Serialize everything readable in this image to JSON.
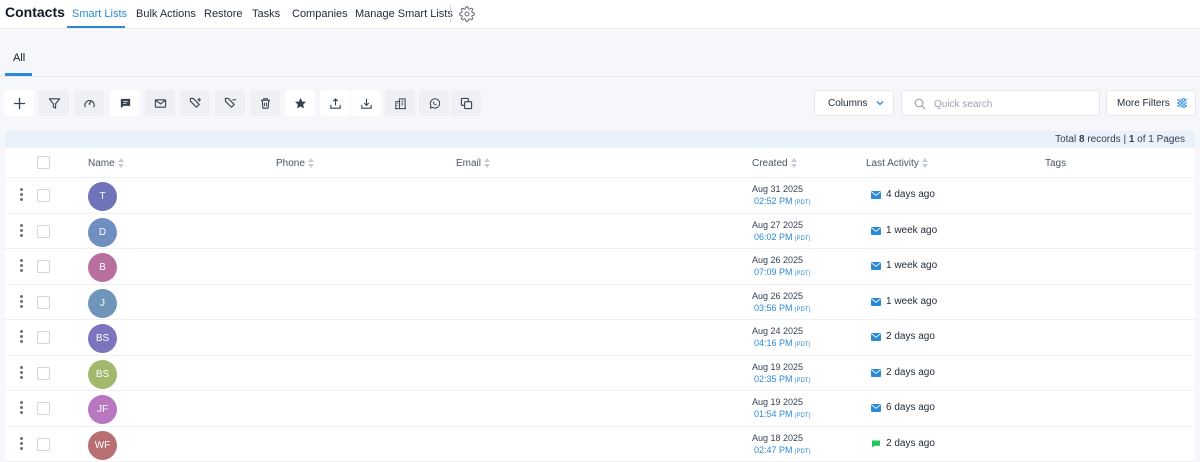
{
  "app": {
    "title": "Contacts"
  },
  "nav": {
    "tabs": [
      {
        "label": "Smart Lists"
      },
      {
        "label": "Bulk Actions"
      },
      {
        "label": "Restore"
      },
      {
        "label": "Tasks"
      },
      {
        "label": "Companies"
      },
      {
        "label": "Manage Smart Lists"
      }
    ],
    "active_tab": "Smart Lists",
    "settings_icon": "gear-icon"
  },
  "subtabs": [
    {
      "label": "All"
    }
  ],
  "toolbar": {
    "icons": [
      "plus-icon",
      "filter-icon",
      "pipeline-icon",
      "sms-icon",
      "email-icon",
      "add-tag-icon",
      "remove-tag-icon",
      "trash-icon",
      "star-icon",
      "export-icon",
      "import-icon",
      "company-icon",
      "whatsapp-icon",
      "merge-icon"
    ],
    "columns_label": "Columns",
    "search_placeholder": "Quick search",
    "more_filters_label": "More Filters"
  },
  "records": {
    "prefix": "Total ",
    "total": "8",
    "middle": " records | ",
    "page": "1",
    "suffix": " of 1 Pages"
  },
  "table": {
    "columns": [
      "Name",
      "Phone",
      "Email",
      "Created",
      "Last Activity",
      "Tags"
    ],
    "rows": [
      {
        "initials": "T",
        "avatar_color": "#6f73b9",
        "created_date": "Aug 31 2025",
        "created_time": "02:52 PM",
        "tz": "(PDT)",
        "activity_icon": "email-icon",
        "activity": "4 days ago"
      },
      {
        "initials": "D",
        "avatar_color": "#6f8fc0",
        "created_date": "Aug 27 2025",
        "created_time": "06:02 PM",
        "tz": "(PDT)",
        "activity_icon": "email-icon",
        "activity": "1 week ago"
      },
      {
        "initials": "B",
        "avatar_color": "#b96f9e",
        "created_date": "Aug 26 2025",
        "created_time": "07:09 PM",
        "tz": "(PDT)",
        "activity_icon": "email-icon",
        "activity": "1 week ago"
      },
      {
        "initials": "J",
        "avatar_color": "#6f95b9",
        "created_date": "Aug 26 2025",
        "created_time": "03:56 PM",
        "tz": "(PDT)",
        "activity_icon": "email-icon",
        "activity": "1 week ago"
      },
      {
        "initials": "BS",
        "avatar_color": "#7c74bf",
        "created_date": "Aug 24 2025",
        "created_time": "04:16 PM",
        "tz": "(PDT)",
        "activity_icon": "email-icon",
        "activity": "2 days ago"
      },
      {
        "initials": "BS",
        "avatar_color": "#a2b86c",
        "created_date": "Aug 19 2025",
        "created_time": "02:35 PM",
        "tz": "(PDT)",
        "activity_icon": "email-icon",
        "activity": "2 days ago"
      },
      {
        "initials": "JF",
        "avatar_color": "#b778c0",
        "created_date": "Aug 19 2025",
        "created_time": "01:54 PM",
        "tz": "(PDT)",
        "activity_icon": "email-icon",
        "activity": "6 days ago"
      },
      {
        "initials": "WF",
        "avatar_color": "#b86f72",
        "created_date": "Aug 18 2025",
        "created_time": "02:47 PM",
        "tz": "(PDT)",
        "activity_icon": "sms-icon",
        "activity": "2 days ago"
      }
    ]
  },
  "colors": {
    "accent": "#2b8ad7",
    "email_icon": "#2b8ad7",
    "sms_icon": "#22c55e"
  }
}
